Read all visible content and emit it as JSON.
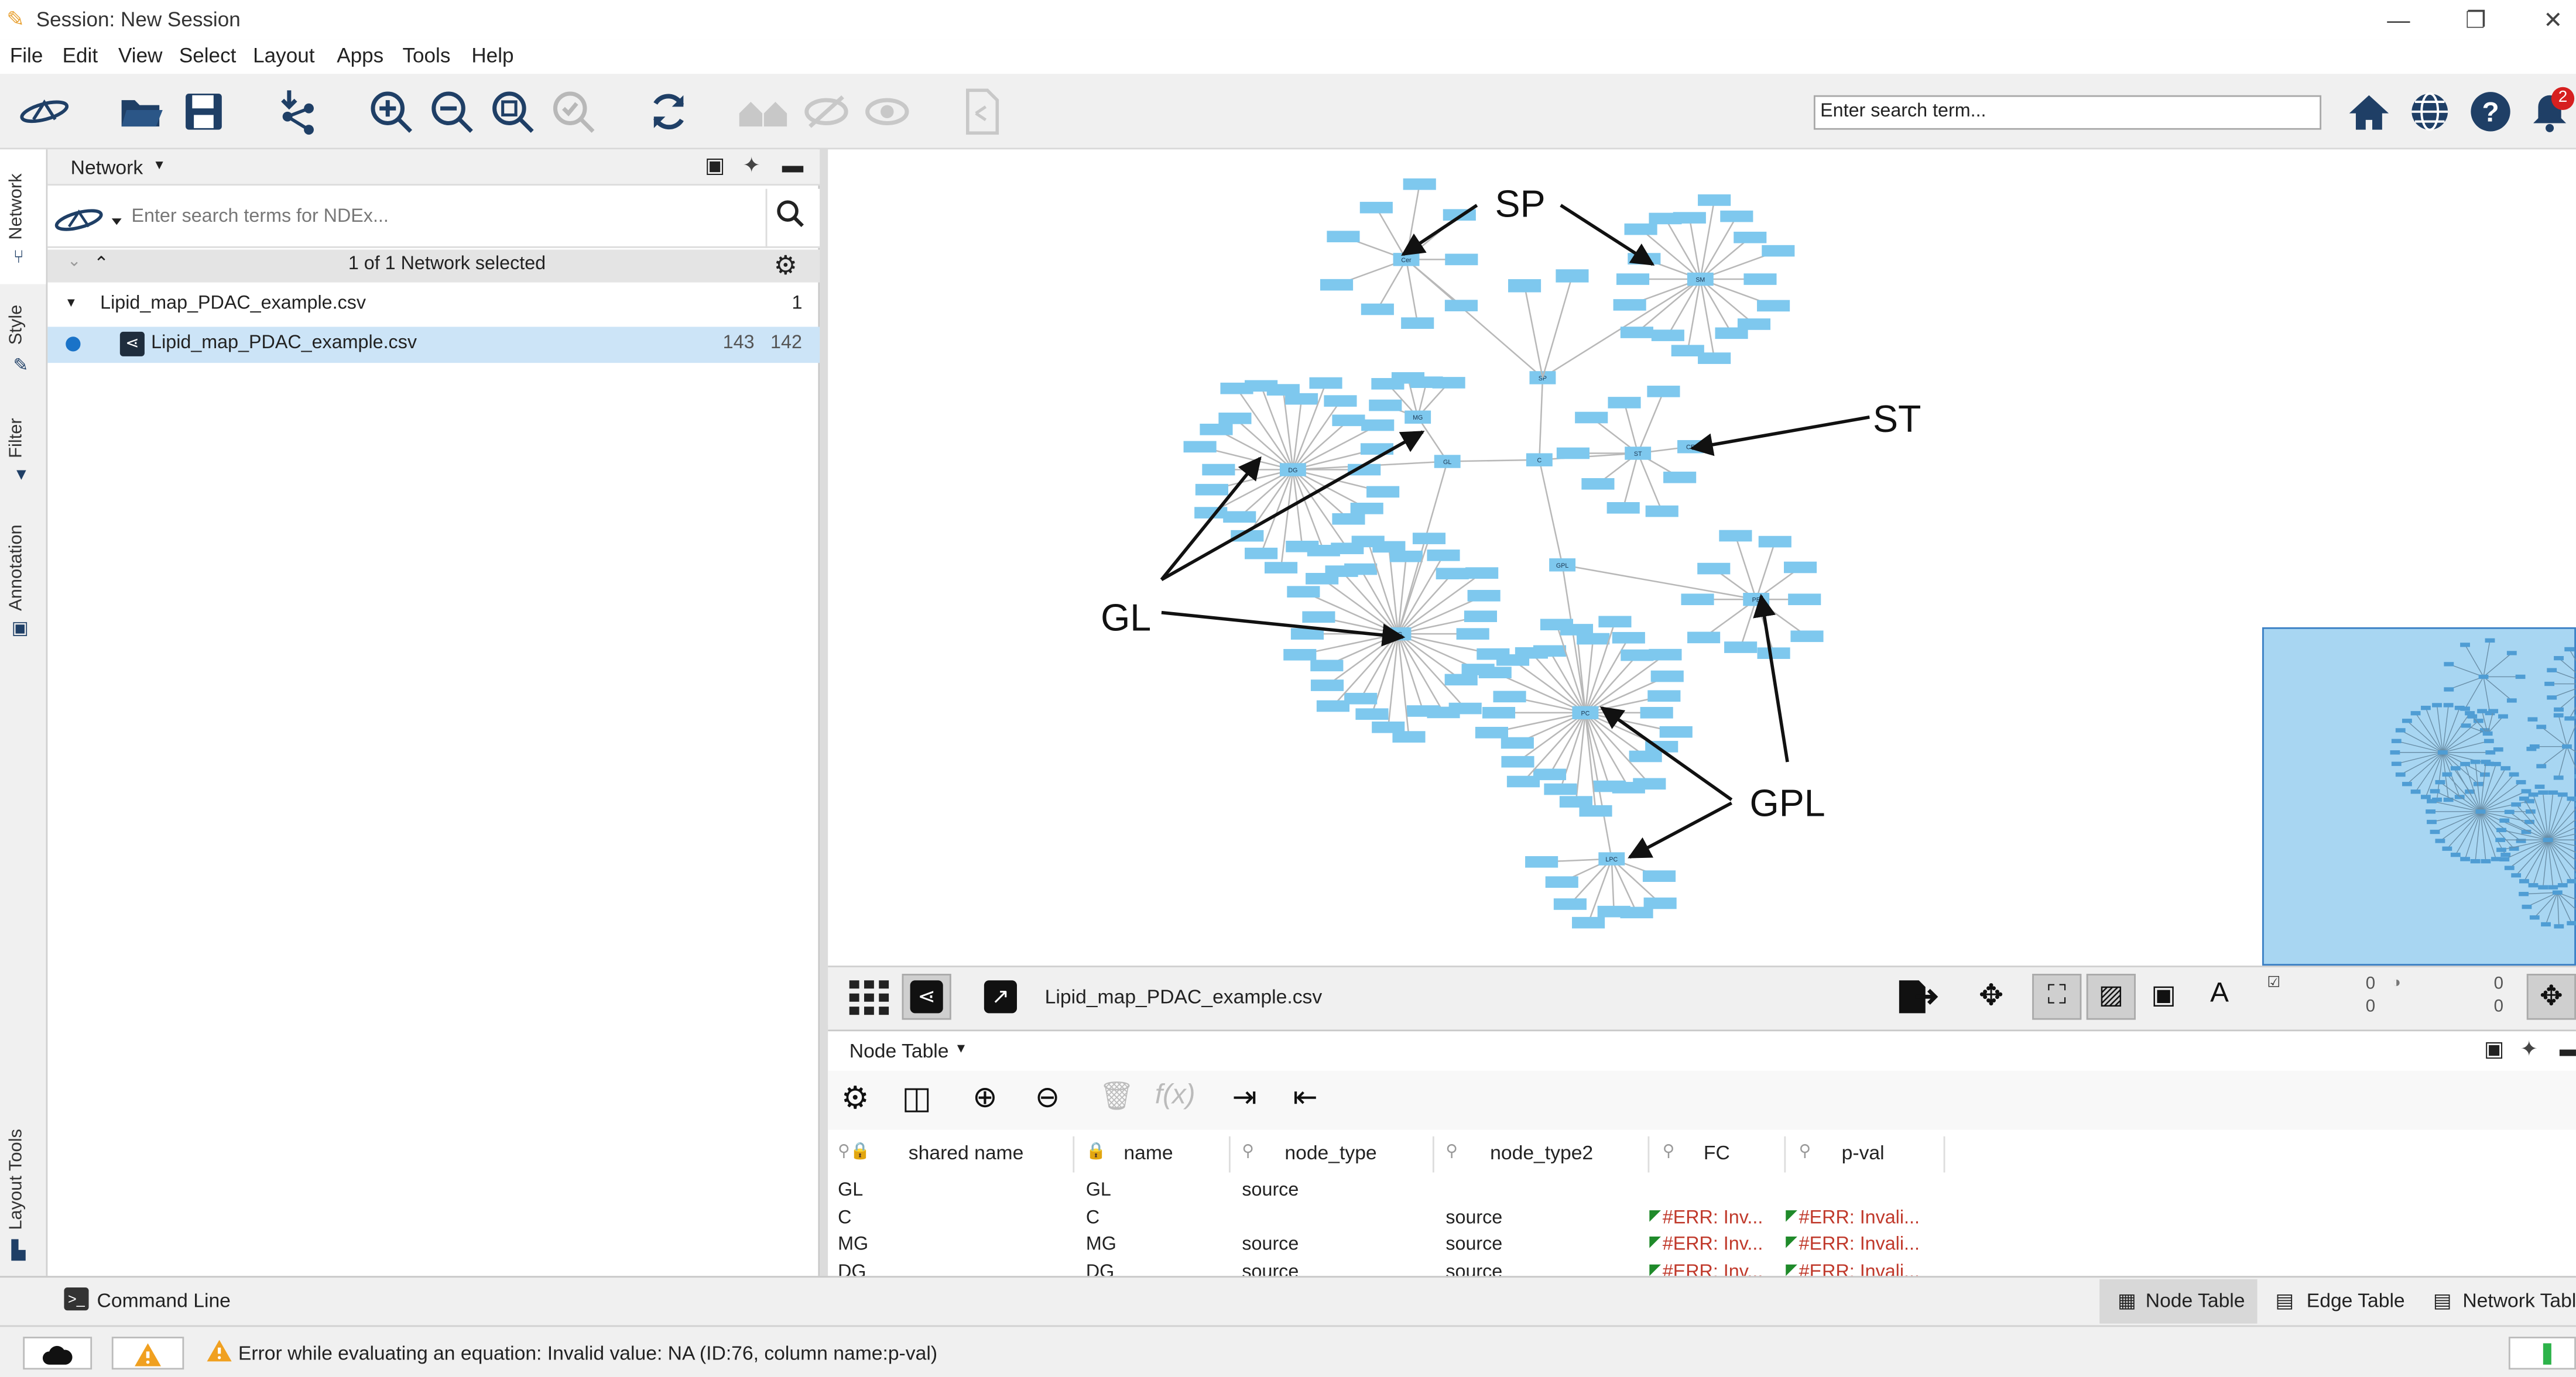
{
  "window": {
    "title": "Session: New Session",
    "minimize_icon": "minimize-icon",
    "restore_icon": "restore-icon",
    "close_icon": "close-icon"
  },
  "menu": [
    "File",
    "Edit",
    "View",
    "Select",
    "Layout",
    "Apps",
    "Tools",
    "Help"
  ],
  "toolbar": {
    "search_placeholder": "Enter search term...",
    "notification_count": "2"
  },
  "side_tabs": [
    "Network",
    "Style",
    "Filter",
    "Annotation",
    "Layout Tools"
  ],
  "network_panel": {
    "header": "Network",
    "ndex_placeholder": "Enter search terms for NDEx...",
    "selection_status": "1 of 1 Network selected",
    "collection": {
      "name": "Lipid_map_PDAC_example.csv",
      "count": "1"
    },
    "network": {
      "name": "Lipid_map_PDAC_example.csv",
      "nodes": "143",
      "edges": "142"
    }
  },
  "canvas": {
    "annotations": [
      "SP",
      "ST",
      "GL",
      "GPL"
    ],
    "hubs": [
      "SP",
      "ST",
      "GL",
      "GPL",
      "C",
      "MG",
      "DG",
      "TG",
      "Cer",
      "SM",
      "PC",
      "PE",
      "LPC",
      "CE"
    ],
    "node_color": "#7ec8ee",
    "edge_color": "#b8b8b8"
  },
  "network_view_bar": {
    "network_name": "Lipid_map_PDAC_example.csv",
    "counts": [
      "0",
      "0",
      "0",
      "0"
    ]
  },
  "table_panel": {
    "title": "Node Table",
    "columns": [
      "shared name",
      "name",
      "node_type",
      "node_type2",
      "FC",
      "p-val"
    ],
    "rows": [
      [
        "GL",
        "GL",
        "source",
        "",
        "",
        ""
      ],
      [
        "C",
        "C",
        "",
        "source",
        "#ERR: Inv...",
        "#ERR: Invali..."
      ],
      [
        "MG",
        "MG",
        "source",
        "source",
        "#ERR: Inv...",
        "#ERR: Invali..."
      ],
      [
        "DG",
        "DG",
        "source",
        "source",
        "#ERR: Inv...",
        "#ERR: Invali..."
      ]
    ]
  },
  "bottom_tabs": {
    "command_line": "Command Line",
    "node_table": "Node Table",
    "edge_table": "Edge Table",
    "network_table": "Network Table"
  },
  "status": {
    "message": "Error while evaluating an equation: Invalid value: NA (ID:76, column name:p-val)"
  }
}
